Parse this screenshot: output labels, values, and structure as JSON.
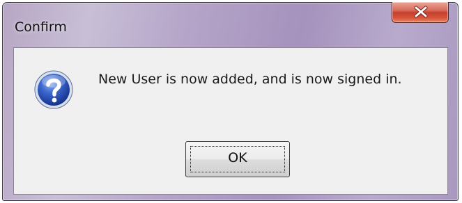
{
  "window": {
    "title": "Confirm"
  },
  "dialog": {
    "icon": "question-icon",
    "message": "New User is now added, and is now signed in.",
    "ok_label": "OK"
  },
  "colors": {
    "frame": "#b5a5c9",
    "client_background": "#f0f0f0",
    "close_button": "#c3402d",
    "icon_blue": "#2a54b8"
  }
}
